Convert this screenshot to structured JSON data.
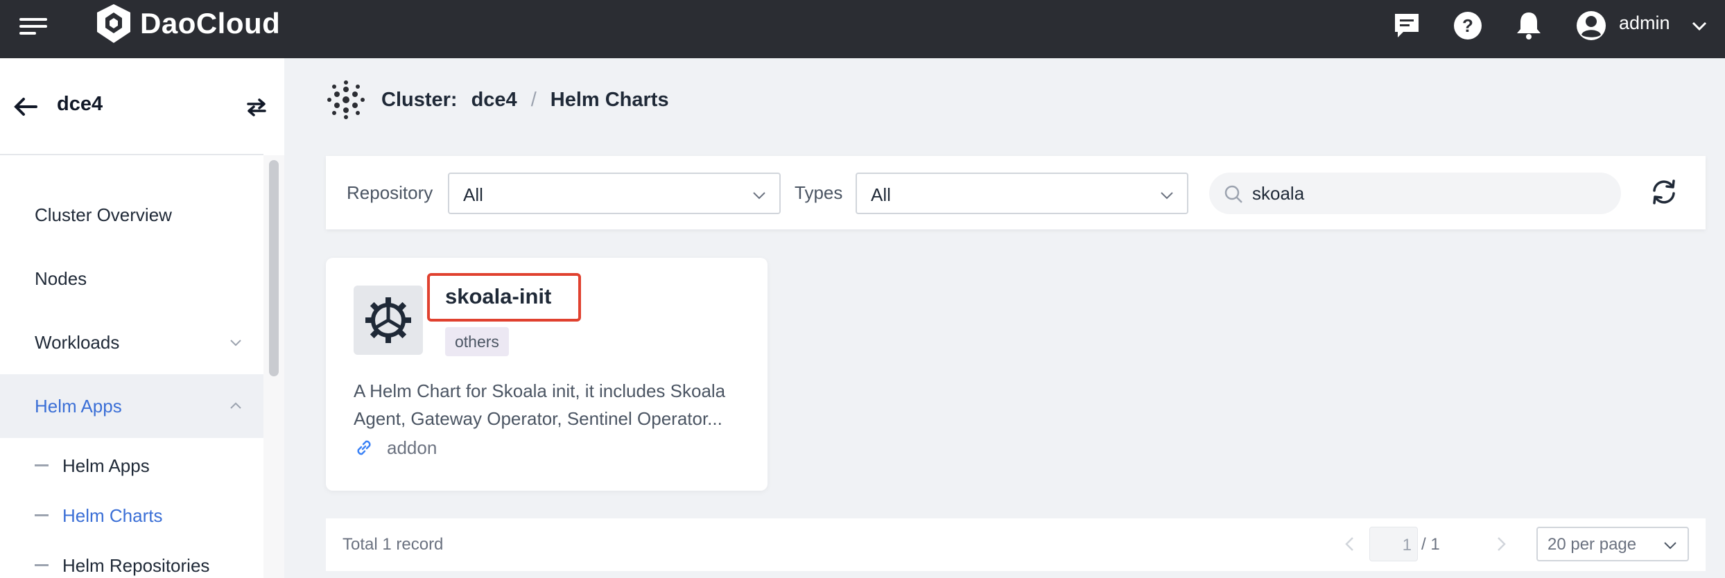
{
  "header": {
    "brand": "DaoCloud",
    "user": "admin",
    "icons": [
      "menu-icon",
      "daocloud-logo-icon",
      "message-icon",
      "help-icon",
      "bell-icon",
      "user-avatar-icon",
      "chevron-down-icon"
    ]
  },
  "sidebar": {
    "cluster": "dce4",
    "items": [
      {
        "label": "Cluster Overview"
      },
      {
        "label": "Nodes"
      },
      {
        "label": "Workloads"
      },
      {
        "label": "Helm Apps"
      }
    ],
    "sub_items": [
      {
        "label": "Helm Apps"
      },
      {
        "label": "Helm Charts"
      },
      {
        "label": "Helm Repositories"
      }
    ],
    "active_color": "#3b6fd6"
  },
  "breadcrumb": {
    "label": "Cluster:",
    "cluster": "dce4",
    "separator": "/",
    "page": "Helm Charts"
  },
  "filters": {
    "repository_label": "Repository",
    "repository_value": "All",
    "types_label": "Types",
    "types_value": "All",
    "search_value": "skoala"
  },
  "card": {
    "title": "skoala-init",
    "tag": "others",
    "description": "A Helm Chart for Skoala init, it includes Skoala Agent, Gateway Operator, Sentinel Operator...",
    "repo": "addon",
    "highlight_color": "#e0412f"
  },
  "pagination": {
    "total": "Total 1 record",
    "page": "1",
    "of": "/ 1",
    "per_page": "20 per page"
  }
}
